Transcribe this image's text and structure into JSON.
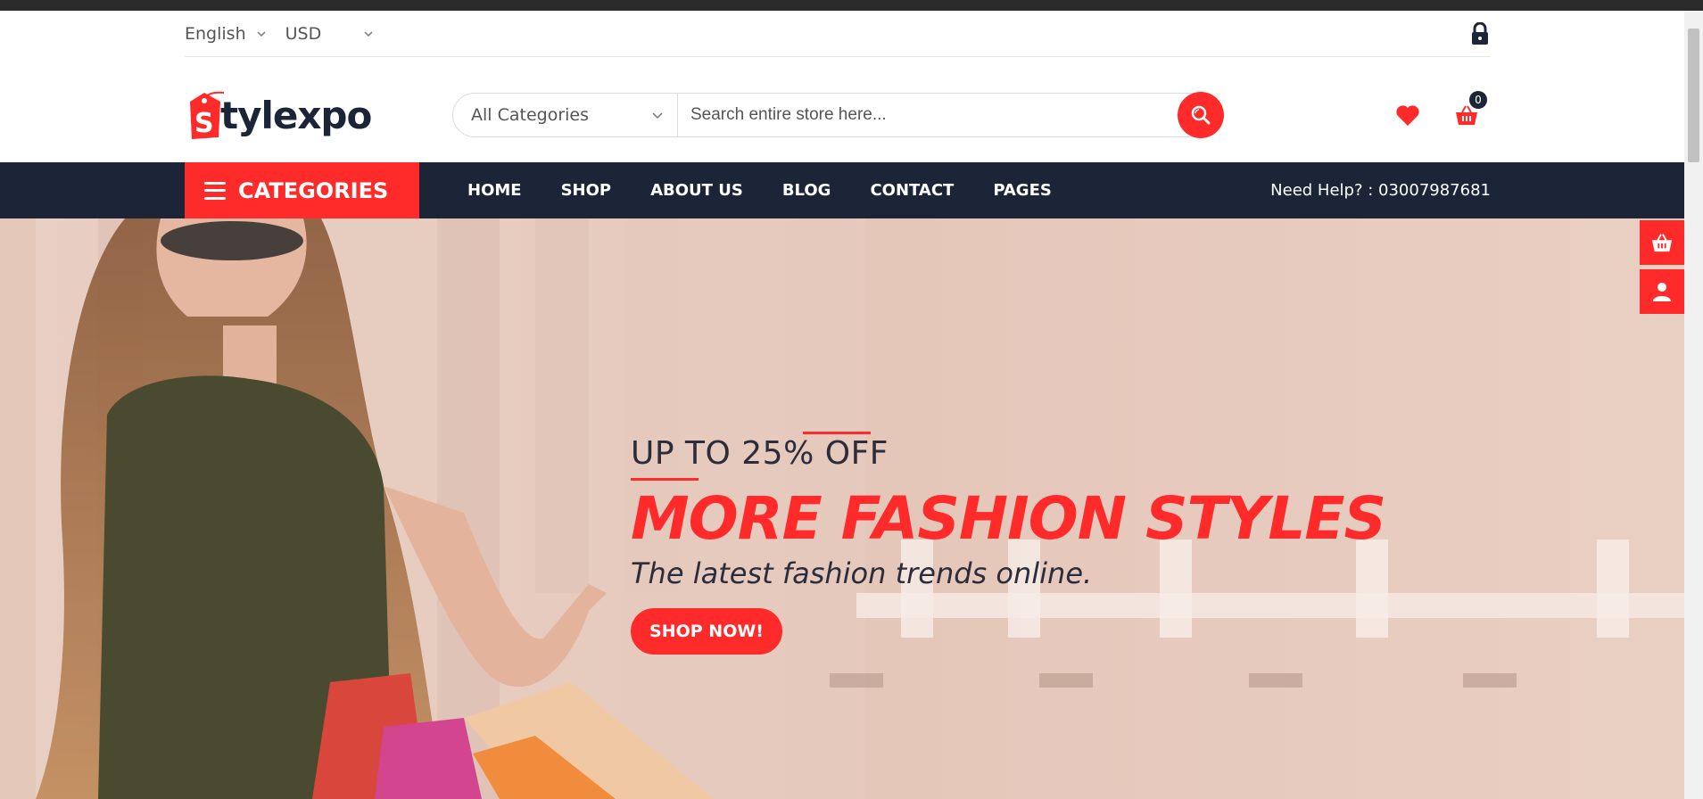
{
  "topbar": {
    "language": "English",
    "currency": "USD"
  },
  "header": {
    "logo_text": "tylexpo",
    "logo_letter": "S",
    "search": {
      "category": "All Categories",
      "placeholder": "Search entire store here..."
    },
    "cart_count": "0"
  },
  "nav": {
    "categories_label": "CATEGORIES",
    "links": [
      "HOME",
      "SHOP",
      "ABOUT US",
      "BLOG",
      "CONTACT",
      "PAGES"
    ],
    "help": "Need Help? : 03007987681"
  },
  "hero": {
    "offer": "UP TO 25% OFF",
    "headline": "MORE FASHION STYLES",
    "tagline": "The latest fashion trends online.",
    "button": "SHOP NOW!"
  },
  "colors": {
    "accent": "#ff2a2a",
    "navy": "#1c2538"
  }
}
